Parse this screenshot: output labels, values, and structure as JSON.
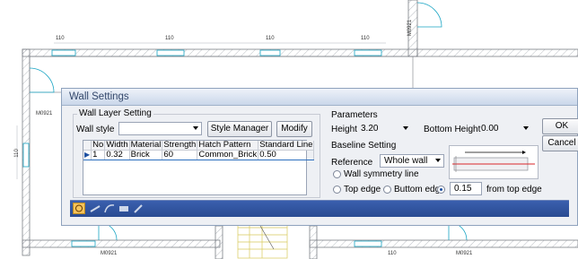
{
  "drawing": {
    "dims": [
      "110",
      "110",
      "110",
      "110",
      "110"
    ],
    "doors": [
      "M0921",
      "M0921",
      "M0921",
      "M0921"
    ],
    "bottom_dim": "110"
  },
  "dialog": {
    "title": "Wall Settings",
    "layer": {
      "title": "Wall Layer Setting",
      "wall_style_label": "Wall style",
      "wall_style_value": "",
      "style_manager": "Style Manager",
      "modify": "Modify",
      "columns": [
        "No",
        "Width",
        "Material",
        "Strength",
        "Hatch Pattern",
        "Standard Line"
      ],
      "rows": [
        {
          "no": "1",
          "width": "0.32",
          "material": "Brick",
          "strength": "60",
          "hatch": "Common_Brick",
          "line": "0.50"
        }
      ]
    },
    "parameters": {
      "title": "Parameters",
      "height_label": "Height",
      "height_value": "3.20",
      "bottom_label": "Bottom Height",
      "bottom_value": "0.00"
    },
    "baseline": {
      "title": "Baseline Setting",
      "reference_label": "Reference",
      "reference_value": "Whole wall",
      "symmetry": "Wall symmetry line",
      "top_edge": "Top edge",
      "bottom_edge": "Buttom edge",
      "offset_value": "0.15",
      "offset_suffix": "from top edge"
    },
    "ok": "OK",
    "cancel": "Cancel",
    "selected_radio": "offset"
  }
}
